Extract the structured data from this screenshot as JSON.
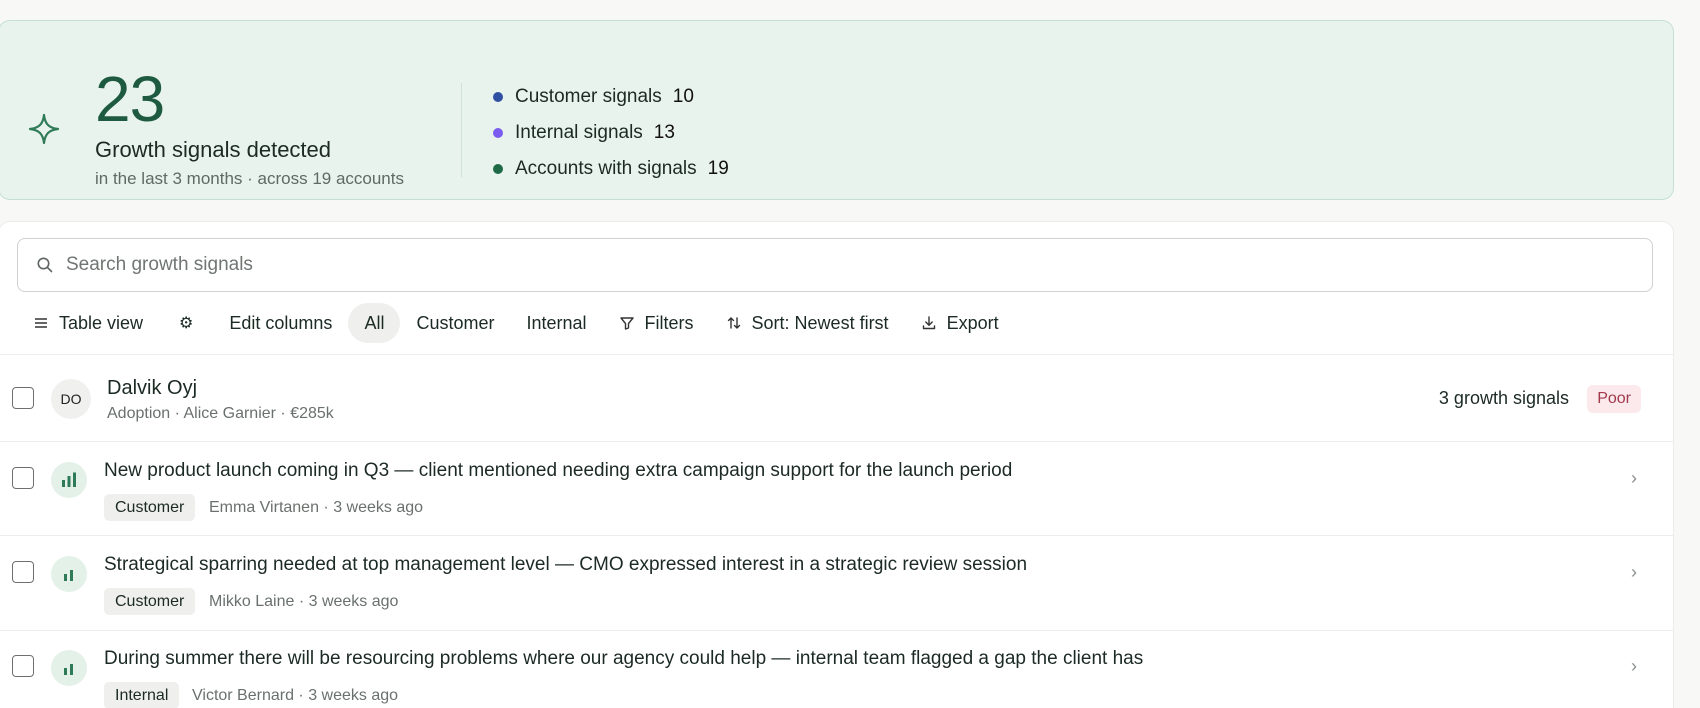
{
  "summary": {
    "total": "23",
    "headline": "Growth signals detected",
    "subtext": "in the last 3 months · across 19 accounts",
    "icon": "sparkle-icon",
    "stats": [
      {
        "label": "Customer signals",
        "value": "10",
        "color": "#2f4fa3"
      },
      {
        "label": "Internal signals",
        "value": "13",
        "color": "#7b5cf0"
      },
      {
        "label": "Accounts with signals",
        "value": "19",
        "color": "#1e6a47"
      }
    ]
  },
  "search": {
    "placeholder": "Search growth signals"
  },
  "toolbar": {
    "table_view": "Table view",
    "settings_icon": "⚙",
    "edit_columns": "Edit columns",
    "filter_all": "All",
    "filter_customer": "Customer",
    "filter_internal": "Internal",
    "filters": "Filters",
    "sort": "Sort: Newest first",
    "export": "Export",
    "active_filter": "All"
  },
  "account": {
    "initials": "DO",
    "name": "Dalvik Oyj",
    "meta": "Adoption · Alice Garnier · €285k",
    "signal_count": "3 growth signals",
    "health": "Poor"
  },
  "signals": [
    {
      "title": "New product launch coming in Q3 — client mentioned needing extra campaign support for the launch period",
      "tag": "Customer",
      "meta": "Emma Virtanen · 3 weeks ago",
      "strength": "high"
    },
    {
      "title": "Strategical sparring needed at top management level — CMO expressed interest in a strategic review session",
      "tag": "Customer",
      "meta": "Mikko Laine · 3 weeks ago",
      "strength": "medium"
    },
    {
      "title": "During summer there will be resourcing problems where our agency could help — internal team flagged a gap the client has",
      "tag": "Internal",
      "meta": "Victor Bernard · 3 weeks ago",
      "strength": "medium"
    }
  ],
  "colors": {
    "accent": "#1e5a40",
    "banner_bg": "#e9f3ee",
    "badge_poor_bg": "#fbe9ec",
    "badge_poor_text": "#a23a4d"
  }
}
